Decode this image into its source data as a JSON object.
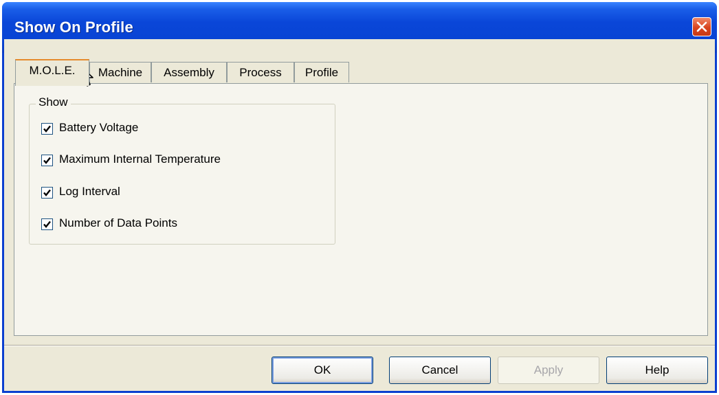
{
  "window": {
    "title": "Show On Profile"
  },
  "tabs": [
    "M.O.L.E.",
    "Machine",
    "Assembly",
    "Process",
    "Profile"
  ],
  "group": {
    "label": "Show",
    "items": [
      {
        "label": "Battery Voltage",
        "checked": true
      },
      {
        "label": "Maximum Internal Temperature",
        "checked": true
      },
      {
        "label": "Log Interval",
        "checked": true
      },
      {
        "label": "Number of Data Points",
        "checked": true
      }
    ]
  },
  "buttons": {
    "ok": "OK",
    "cancel": "Cancel",
    "apply": "Apply",
    "help": "Help"
  },
  "colors": {
    "titlebar": "#0a46d8",
    "close_button": "#d8431e",
    "dialog_face": "#ece9d8",
    "active_tab_accent": "#e68b2c"
  }
}
